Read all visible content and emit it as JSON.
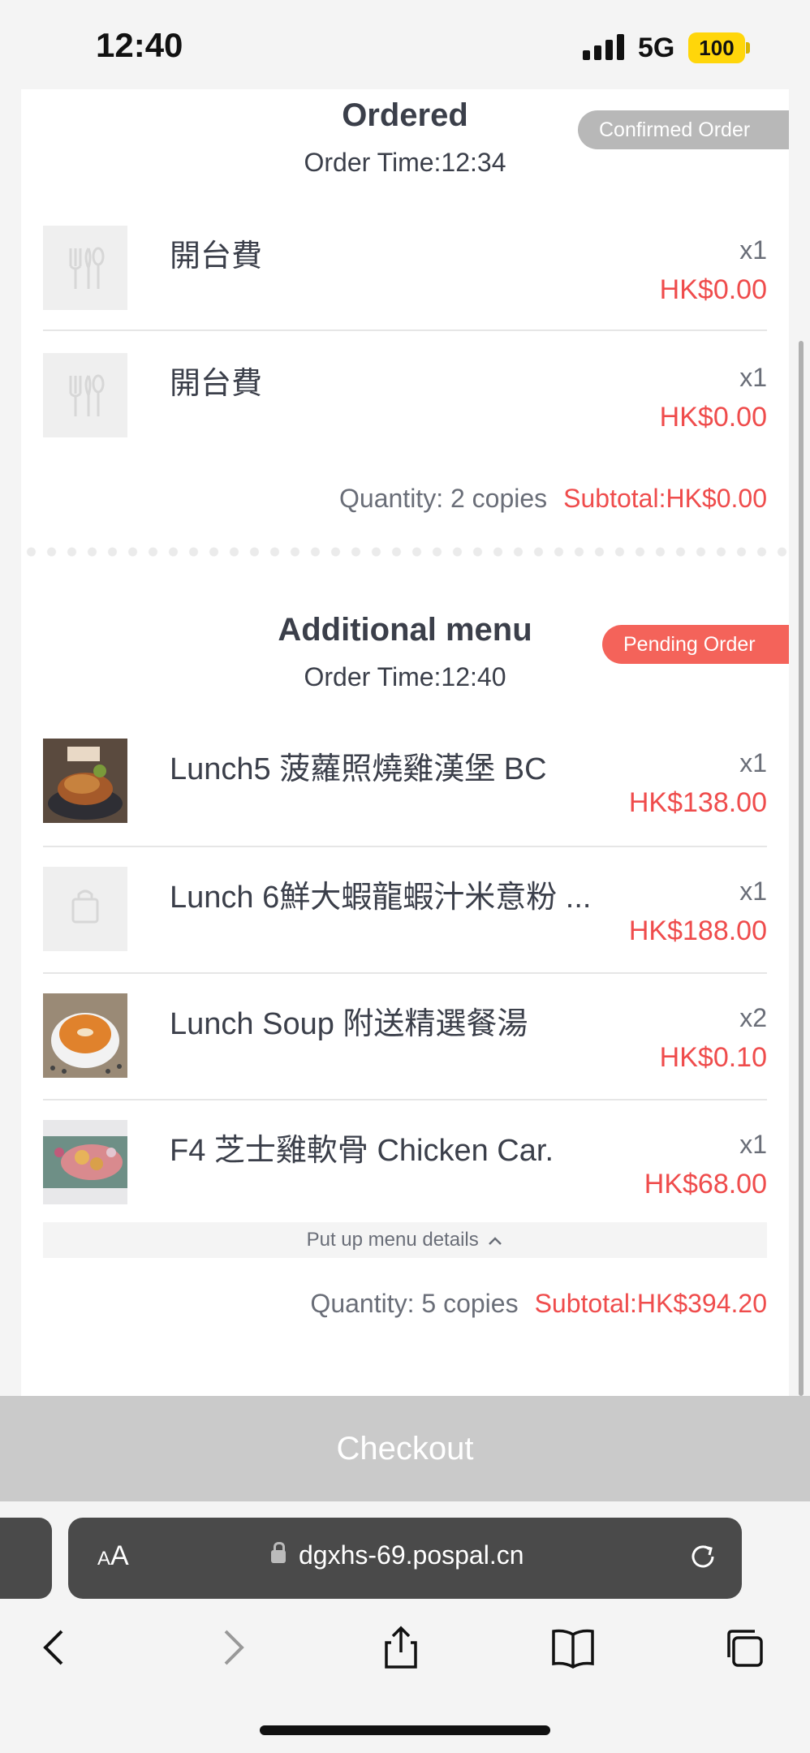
{
  "status_bar": {
    "time": "12:40",
    "network": "5G",
    "battery": "100"
  },
  "ordered": {
    "title": "Ordered",
    "badge": "Confirmed Order",
    "order_time": "Order Time:12:34",
    "items": [
      {
        "name": "開台費",
        "qty": "x1",
        "price": "HK$0.00",
        "image": "utensils-placeholder"
      },
      {
        "name": "開台費",
        "qty": "x1",
        "price": "HK$0.00",
        "image": "utensils-placeholder"
      }
    ],
    "quantity": "Quantity: 2 copies",
    "subtotal": "Subtotal:HK$0.00"
  },
  "additional": {
    "title": "Additional menu",
    "badge": "Pending Order",
    "order_time": "Order Time:12:40",
    "items": [
      {
        "name": "Lunch5 菠蘿照燒雞漢堡 BC",
        "qty": "x1",
        "price": "HK$138.00",
        "image": "burger-photo"
      },
      {
        "name": "Lunch 6鮮大蝦龍蝦汁米意粉 ...",
        "qty": "x1",
        "price": "HK$188.00",
        "image": "bag-placeholder"
      },
      {
        "name": "Lunch Soup 附送精選餐湯",
        "qty": "x2",
        "price": "HK$0.10",
        "image": "soup-photo"
      },
      {
        "name": "F4 芝士雞軟骨 Chicken Car.",
        "qty": "x1",
        "price": "HK$68.00",
        "image": "chicken-photo"
      }
    ],
    "details_toggle": "Put up menu details",
    "quantity": "Quantity: 5 copies",
    "subtotal": "Subtotal:HK$394.20"
  },
  "checkout_label": "Checkout",
  "browser": {
    "aa_small": "A",
    "aa_large": "A",
    "url": "dgxhs-69.pospal.cn"
  },
  "colors": {
    "accent_red": "#ef4c4c",
    "pending_badge": "#f4635a",
    "confirmed_badge": "#b8b8b8",
    "battery": "#ffd60a"
  }
}
